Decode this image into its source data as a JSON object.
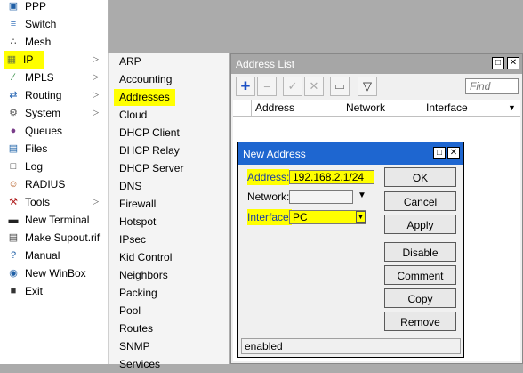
{
  "main_menu": {
    "items": [
      {
        "label": "PPP",
        "icon": "ppp-icon",
        "glyph": "▣",
        "color": "#1f5fa6",
        "submenu": false
      },
      {
        "label": "Switch",
        "icon": "switch-icon",
        "glyph": "≡",
        "color": "#4a7fc1",
        "submenu": false
      },
      {
        "label": "Mesh",
        "icon": "mesh-icon",
        "glyph": "∴",
        "color": "#444444",
        "submenu": false
      },
      {
        "label": "IP",
        "icon": "ip-icon",
        "glyph": "▦",
        "color": "#6b7b3a",
        "submenu": true,
        "highlighted": true
      },
      {
        "label": "MPLS",
        "icon": "mpls-icon",
        "glyph": "∕",
        "color": "#2b8a3e",
        "submenu": true
      },
      {
        "label": "Routing",
        "icon": "routing-icon",
        "glyph": "⇄",
        "color": "#1c5fb0",
        "submenu": true
      },
      {
        "label": "System",
        "icon": "system-icon",
        "glyph": "⚙",
        "color": "#555555",
        "submenu": true
      },
      {
        "label": "Queues",
        "icon": "queues-icon",
        "glyph": "●",
        "color": "#7a3d8a",
        "submenu": false
      },
      {
        "label": "Files",
        "icon": "files-icon",
        "glyph": "▤",
        "color": "#2266aa",
        "submenu": false
      },
      {
        "label": "Log",
        "icon": "log-icon",
        "glyph": "□",
        "color": "#333333",
        "submenu": false
      },
      {
        "label": "RADIUS",
        "icon": "radius-icon",
        "glyph": "☺",
        "color": "#b35a1f",
        "submenu": false
      },
      {
        "label": "Tools",
        "icon": "tools-icon",
        "glyph": "⚒",
        "color": "#b02020",
        "submenu": true
      },
      {
        "label": "New Terminal",
        "icon": "terminal-icon",
        "glyph": "▬",
        "color": "#222222",
        "submenu": false
      },
      {
        "label": "Make Supout.rif",
        "icon": "supout-icon",
        "glyph": "▤",
        "color": "#444444",
        "submenu": false
      },
      {
        "label": "Manual",
        "icon": "manual-icon",
        "glyph": "?",
        "color": "#1f5fa6",
        "submenu": false
      },
      {
        "label": "New WinBox",
        "icon": "winbox-icon",
        "glyph": "◉",
        "color": "#1f5fa6",
        "submenu": false
      },
      {
        "label": "Exit",
        "icon": "exit-icon",
        "glyph": "■",
        "color": "#333333",
        "submenu": false
      }
    ]
  },
  "submenu": {
    "items": [
      {
        "label": "ARP"
      },
      {
        "label": "Accounting"
      },
      {
        "label": "Addresses",
        "highlighted": true
      },
      {
        "label": "Cloud"
      },
      {
        "label": "DHCP Client"
      },
      {
        "label": "DHCP Relay"
      },
      {
        "label": "DHCP Server"
      },
      {
        "label": "DNS"
      },
      {
        "label": "Firewall"
      },
      {
        "label": "Hotspot"
      },
      {
        "label": "IPsec"
      },
      {
        "label": "Kid Control"
      },
      {
        "label": "Neighbors"
      },
      {
        "label": "Packing"
      },
      {
        "label": "Pool"
      },
      {
        "label": "Routes"
      },
      {
        "label": "SNMP"
      },
      {
        "label": "Services"
      }
    ]
  },
  "address_list": {
    "title": "Address List",
    "find_placeholder": "Find",
    "columns": [
      "Address",
      "Network",
      "Interface"
    ],
    "toolbar": [
      {
        "icon": "add-icon",
        "glyph": "✚",
        "color": "#1a4fc4"
      },
      {
        "icon": "remove-icon",
        "glyph": "−",
        "color": "#aaaaaa"
      },
      {
        "icon": "enable-icon",
        "glyph": "✓",
        "color": "#aaaaaa"
      },
      {
        "icon": "disable-icon",
        "glyph": "✕",
        "color": "#aaaaaa"
      },
      {
        "icon": "comment-icon",
        "glyph": "▭",
        "color": "#777777"
      },
      {
        "icon": "filter-icon",
        "glyph": "▽",
        "color": "#222222"
      }
    ]
  },
  "new_address": {
    "title": "New Address",
    "address_label": "Address:",
    "address_value": "192.168.2.1/24",
    "network_label": "Network:",
    "network_value": "",
    "interface_label": "Interface:",
    "interface_value": "PC",
    "buttons": [
      "OK",
      "Cancel",
      "Apply",
      "Disable",
      "Comment",
      "Copy",
      "Remove"
    ],
    "status": "enabled"
  },
  "colors": {
    "highlight": "#ffff00",
    "dialog_titlebar": "#1e66d0",
    "inactive_titlebar": "#a6a6a6"
  }
}
